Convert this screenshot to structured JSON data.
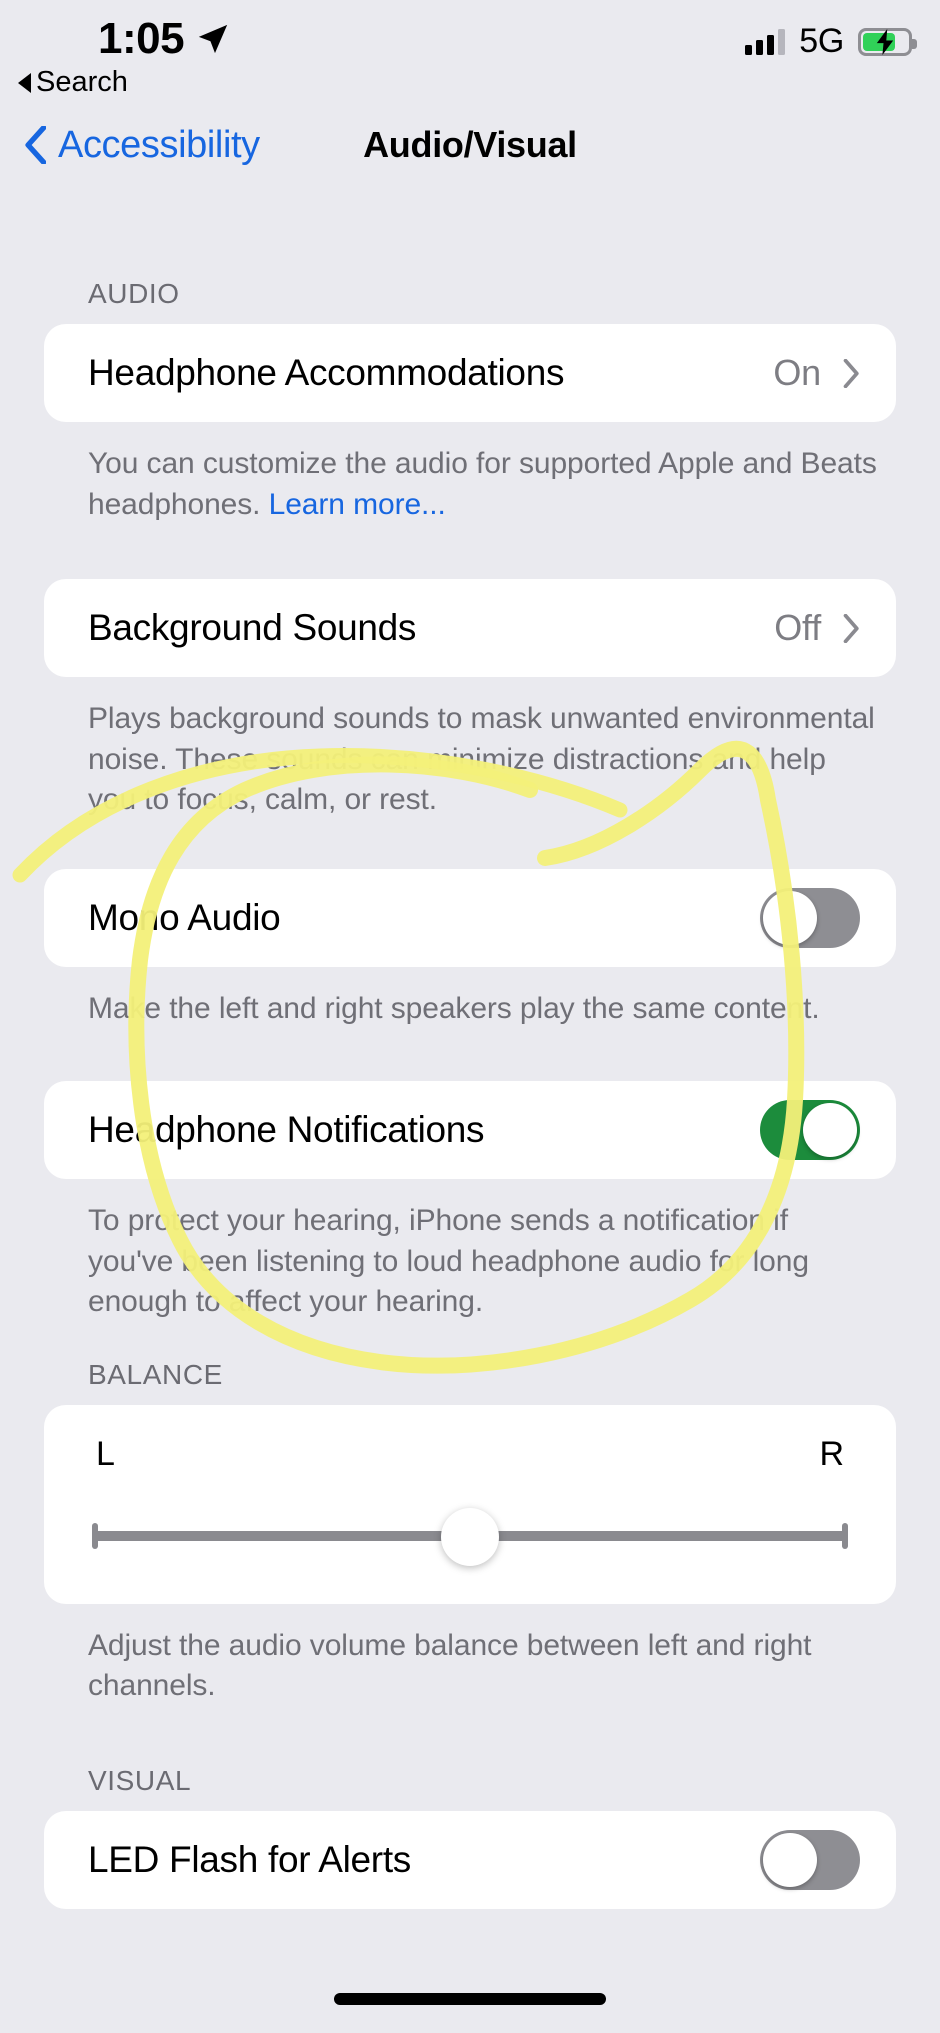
{
  "status_bar": {
    "time": "1:05",
    "location_icon": "location-arrow-icon",
    "signal_icon": "cellular-bars-icon",
    "network": "5G",
    "battery_icon": "battery-charging-icon",
    "back_to_app": "Search"
  },
  "nav": {
    "back_label": "Accessibility",
    "title": "Audio/Visual"
  },
  "sections": {
    "audio": {
      "header": "AUDIO",
      "headphone_accommodations": {
        "label": "Headphone Accommodations",
        "value": "On",
        "footnote_text": "You can customize the audio for supported Apple and Beats headphones. ",
        "footnote_link": "Learn more..."
      },
      "background_sounds": {
        "label": "Background Sounds",
        "value": "Off",
        "footnote": "Plays background sounds to mask unwanted environmental noise. These sounds can minimize distractions and help you to focus, calm, or rest."
      },
      "mono_audio": {
        "label": "Mono Audio",
        "state": "off",
        "footnote": "Make the left and right speakers play the same content."
      },
      "headphone_notifications": {
        "label": "Headphone Notifications",
        "state": "on",
        "footnote": "To protect your hearing, iPhone sends a notification if you've been listening to loud headphone audio for long enough to affect your hearing."
      }
    },
    "balance": {
      "header": "BALANCE",
      "left_label": "L",
      "right_label": "R",
      "value_percent": 50,
      "footnote": "Adjust the audio volume balance between left and right channels."
    },
    "visual": {
      "header": "VISUAL",
      "led_flash": {
        "label": "LED Flash for Alerts",
        "state": "off"
      }
    }
  },
  "annotation": {
    "type": "hand-drawn-ellipse",
    "color": "#f2ef72",
    "target": "Headphone Notifications"
  },
  "colors": {
    "background": "#eaeaef",
    "card": "#ffffff",
    "accent_blue": "#1766e0",
    "toggle_on_green": "#1c8c3c",
    "toggle_off_gray": "#8e8e93",
    "secondary_text": "#6f6f76",
    "battery_green": "#30d158"
  }
}
